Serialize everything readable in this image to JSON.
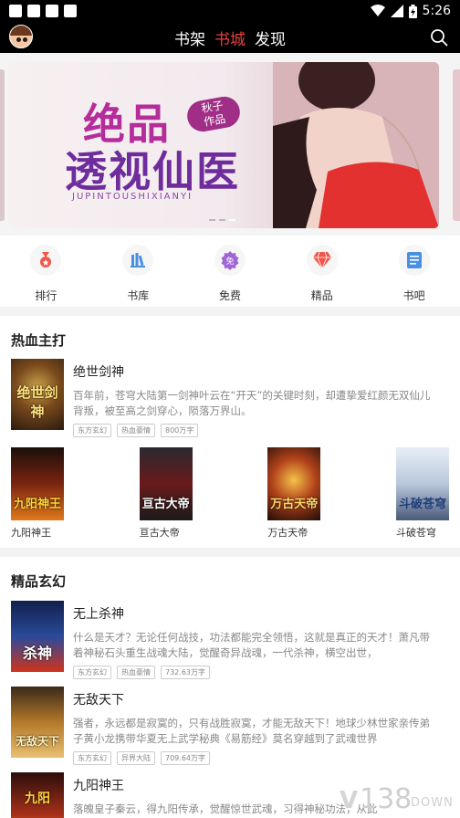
{
  "status_bar": {
    "time": "5:26"
  },
  "header": {
    "tabs": [
      {
        "label": "书架",
        "active": false
      },
      {
        "label": "书城",
        "active": true
      },
      {
        "label": "发现",
        "active": false
      }
    ],
    "accent_color": "#e8403c"
  },
  "banner": {
    "title_line1": "绝品",
    "title_line2": "透视仙医",
    "author_line1": "秋子",
    "author_line2": "作品",
    "pinyin": "JUPINTOUSHIXIANYI"
  },
  "categories": [
    {
      "label": "排行",
      "icon": "medal-icon",
      "color": "#f0574a"
    },
    {
      "label": "书库",
      "icon": "library-icon",
      "color": "#4a90e2"
    },
    {
      "label": "免费",
      "icon": "free-badge-icon",
      "color": "#9b59d0"
    },
    {
      "label": "精品",
      "icon": "diamond-icon",
      "color": "#f0574a"
    },
    {
      "label": "书吧",
      "icon": "document-icon",
      "color": "#4a90e2"
    }
  ],
  "section_hot": {
    "title": "热血主打",
    "featured": {
      "cover_title": "绝世剑神",
      "name": "绝世剑神",
      "desc": "百年前，苍穹大陆第一剑神叶云在“开天”的关键时刻，却遭挚爱红颜无双仙儿背叛，被至高之剑穿心，陨落万界山。",
      "tags": [
        "东方玄幻",
        "热血豪情",
        "800万字"
      ]
    },
    "books": [
      {
        "name": "九阳神王",
        "cover_title": "九阳神王"
      },
      {
        "name": "亘古大帝",
        "cover_title": "亘古大帝"
      },
      {
        "name": "万古天帝",
        "cover_title": "万古天帝"
      },
      {
        "name": "斗破苍穹",
        "cover_title": "斗破苍穹"
      }
    ]
  },
  "section_xuanhuan": {
    "title": "精品玄幻",
    "books": [
      {
        "name": "无上杀神",
        "cover_title": "杀神",
        "desc": "什么是天才？无论任何战技，功法都能完全领悟，这就是真正的天才！萧凡带着神秘石头重生战魂大陆，觉醒奇异战魂，一代杀神，横空出世，",
        "tags": [
          "东方玄幻",
          "热血豪情",
          "732.63万字"
        ]
      },
      {
        "name": "无敌天下",
        "cover_title": "无敌天下",
        "desc": "强者，永远都是寂寞的，只有战胜寂寞，才能无敌天下！地球少林世家亲传弟子黄小龙携带华夏无上武学秘典《易筋经》莫名穿越到了武魂世界",
        "tags": [
          "东方玄幻",
          "异界大陆",
          "709.64万字"
        ]
      },
      {
        "name": "九阳神王",
        "cover_title": "九阳",
        "desc": "落魄皇子秦云，得九阳传承，觉醒惊世武魂，习得神秘功法，从此",
        "tags": []
      }
    ]
  },
  "watermark": {
    "num": "138",
    "txt": "DOWN"
  }
}
